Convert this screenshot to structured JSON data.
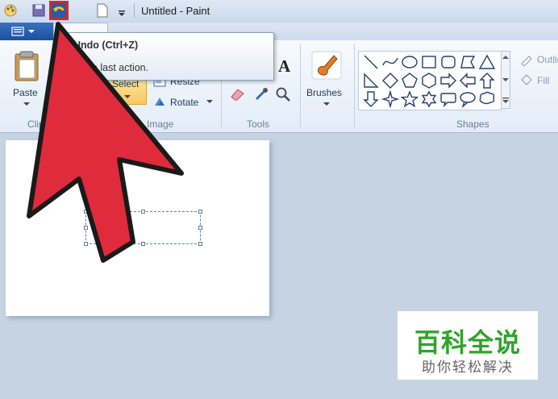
{
  "window": {
    "title": "Untitled - Paint"
  },
  "tooltip": {
    "title": "Undo (Ctrl+Z)",
    "description": "Undo last action."
  },
  "ribbon": {
    "clipboard": {
      "paste_label": "Paste",
      "group_label": "Clipboard"
    },
    "image": {
      "select_label": "Select",
      "resize_label": "Resize",
      "rotate_label": "Rotate",
      "group_label": "Image"
    },
    "tools": {
      "group_label": "Tools"
    },
    "brushes": {
      "label": "Brushes"
    },
    "shapes": {
      "group_label": "Shapes",
      "outline_label": "Outline",
      "fill_label": "Fill"
    }
  },
  "watermark": {
    "brand": "百科全说",
    "tagline": "助你轻松解决"
  },
  "colors": {
    "arrow": "#e02b3c",
    "accent": "#1d4f9f",
    "watermark_green": "#2ea42a"
  }
}
